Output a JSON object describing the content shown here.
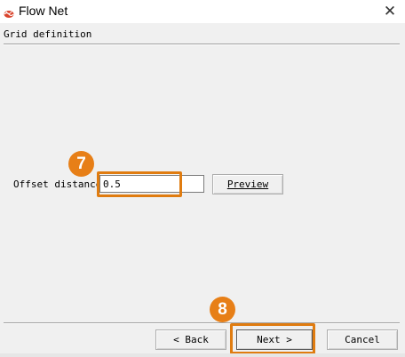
{
  "window": {
    "title": "Flow Net",
    "icon": "flow-net-app-icon",
    "close_glyph": "✕"
  },
  "wizard": {
    "step_title": "Grid definition",
    "offset_label": "Offset distance",
    "offset_value": "0.5",
    "preview_label": "Preview",
    "back_label": "< Back",
    "next_label": "Next >",
    "cancel_label": "Cancel"
  },
  "annotations": {
    "step7": "7",
    "step8": "8",
    "highlight_color": "#e07c10",
    "badge_color": "#e77f17"
  }
}
